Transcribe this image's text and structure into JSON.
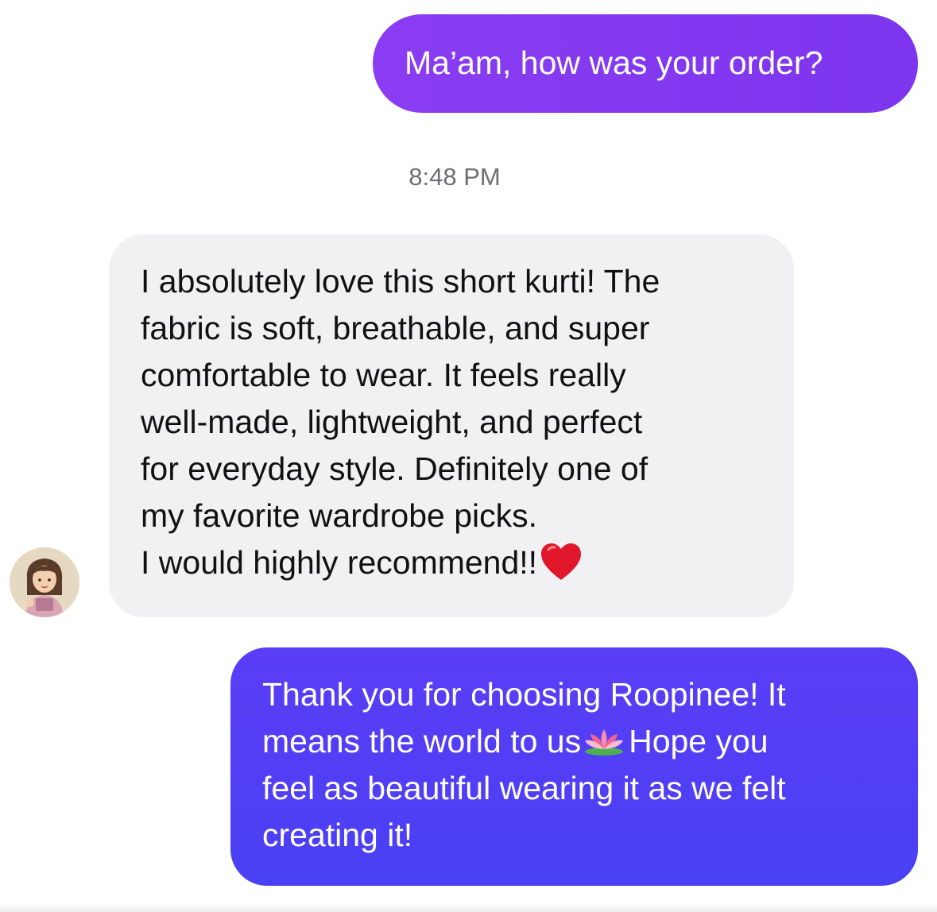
{
  "messages": {
    "outgoing_1": {
      "text": "Ma’am, how was your order?"
    },
    "timestamp": "8:48 PM",
    "incoming": {
      "lines": [
        "I absolutely love this short kurti! The",
        "fabric is soft, breathable, and super",
        "comfortable to wear. It feels really",
        "well-made, lightweight, and perfect",
        "for everyday style. Definitely one of",
        "my favorite wardrobe picks.",
        "I would highly recommend!!"
      ],
      "emoji": "red-heart"
    },
    "outgoing_2": {
      "lines": [
        "Thank you for choosing Roopinee! It",
        "means the world to us",
        "Hope you",
        "feel as beautiful wearing it as we felt",
        "creating it!"
      ],
      "emoji": "lotus"
    }
  },
  "colors": {
    "outgoing_1_bubble": "#8a3df2",
    "outgoing_2_bubble": "#4f3ef5",
    "incoming_bubble": "#f1f1f3",
    "timestamp_text": "#6e6e73",
    "heart": "#e0162b"
  },
  "icons": {
    "avatar": "user-avatar-illustration",
    "heart": "red-heart-emoji",
    "lotus": "lotus-emoji"
  }
}
